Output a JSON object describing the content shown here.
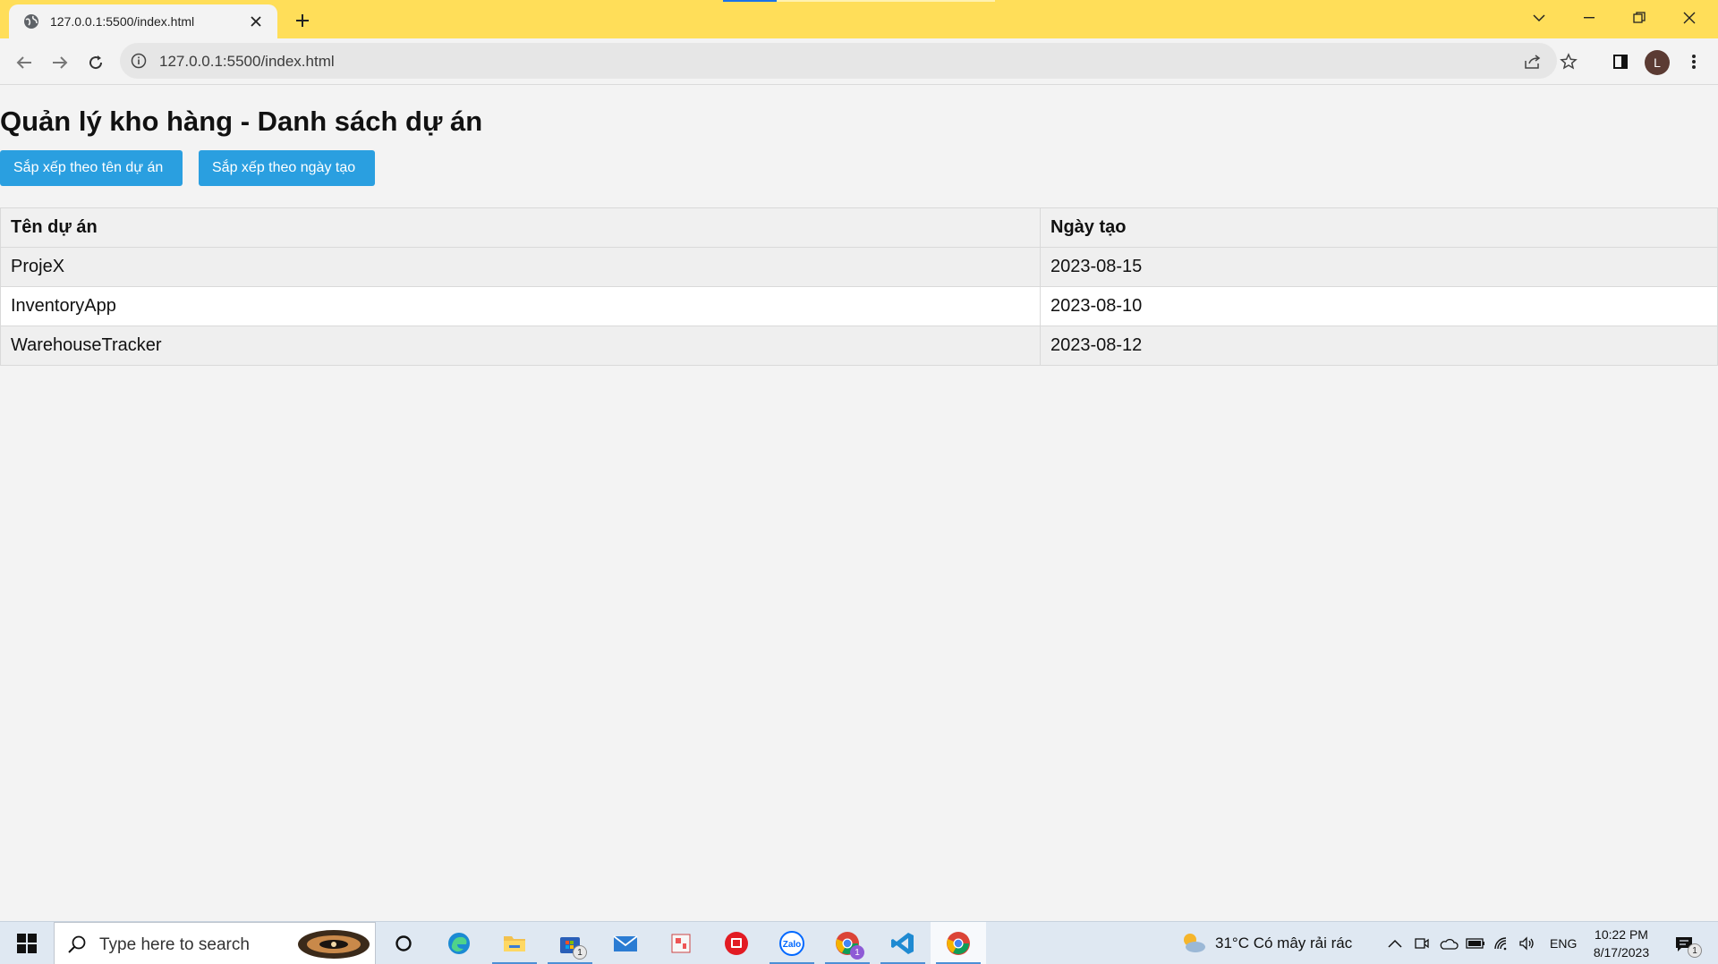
{
  "browser": {
    "tab_title": "127.0.0.1:5500/index.html",
    "url": "127.0.0.1:5500/index.html",
    "profile_initial": "L",
    "accent_color": "#ffde59"
  },
  "page": {
    "title": "Quản lý kho hàng - Danh sách dự án",
    "sort_by_name_label": "Sắp xếp theo tên dự án",
    "sort_by_date_label": "Sắp xếp theo ngày tạo",
    "button_color": "#2a9fe0",
    "table": {
      "headers": [
        "Tên dự án",
        "Ngày tạo"
      ],
      "rows": [
        {
          "name": "ProjeX",
          "date": "2023-08-15"
        },
        {
          "name": "InventoryApp",
          "date": "2023-08-10"
        },
        {
          "name": "WarehouseTracker",
          "date": "2023-08-12"
        }
      ]
    }
  },
  "taskbar": {
    "search_placeholder": "Type here to search",
    "store_badge": "1",
    "chrome_badge": "1",
    "weather": "31°C  Có mây rải rác",
    "language": "ENG",
    "time": "10:22 PM",
    "date": "8/17/2023",
    "notification_badge": "1",
    "apps": [
      "task-view",
      "edge",
      "file-explorer",
      "microsoft-store",
      "mail",
      "snipping-tool",
      "red-app",
      "zalo",
      "chrome-profile",
      "vscode",
      "chrome"
    ]
  }
}
